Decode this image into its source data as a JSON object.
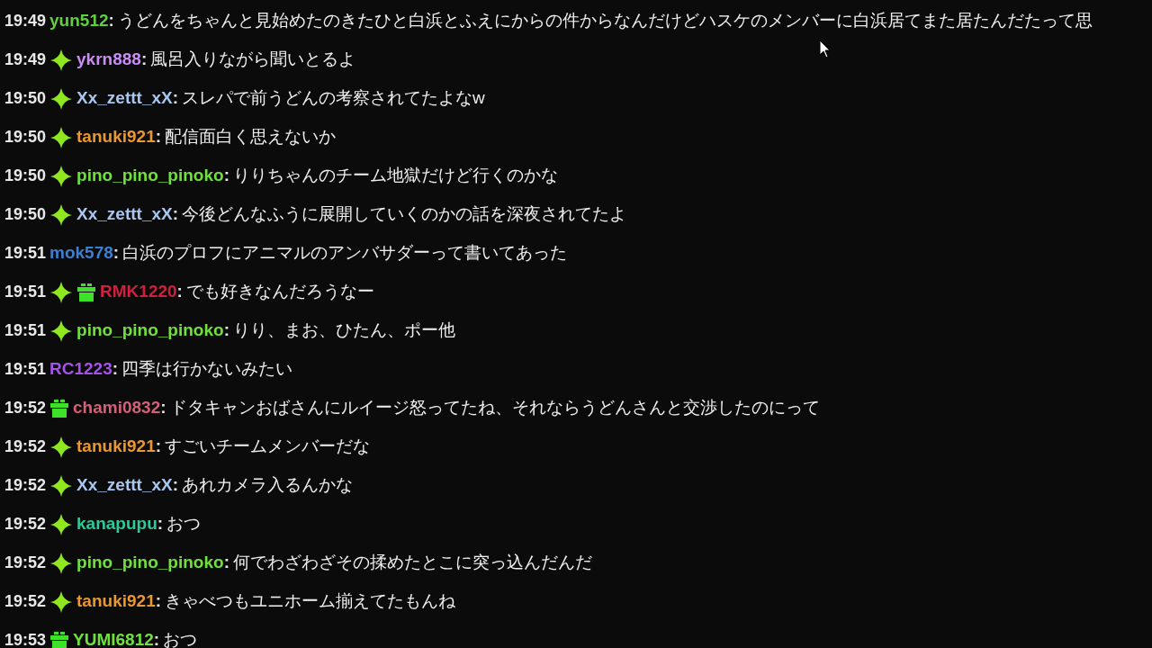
{
  "messages": [
    {
      "time": "19:49",
      "user": "yun512",
      "color": "#5fd13c",
      "separator": ":",
      "text": "うどんをちゃんと見始めたのきたひと白浜とふえにからの件からなんだけどハスケのメンバーに白浜居てまた居たんだたって思"
    },
    {
      "time": "19:49",
      "badges": [
        {
          "kind": "sparkle"
        }
      ],
      "user": "ykrn888",
      "color": "#c98cf5",
      "separator": ":",
      "text": "風呂入りながら聞いとるよ"
    },
    {
      "time": "19:50",
      "badges": [
        {
          "kind": "sparkle"
        }
      ],
      "user": "Xx_zettt_xX",
      "color": "#a9c6ee",
      "separator": ":",
      "text": "スレパで前うどんの考察されてたよなw"
    },
    {
      "time": "19:50",
      "badges": [
        {
          "kind": "sparkle"
        }
      ],
      "user": "tanuki921",
      "color": "#e8982f",
      "separator": ":",
      "text": "配信面白く思えないか"
    },
    {
      "time": "19:50",
      "badges": [
        {
          "kind": "sparkle"
        }
      ],
      "user": "pino_pino_pinoko",
      "color": "#70e03c",
      "separator": ":",
      "text": "りりちゃんのチーム地獄だけど行くのかな"
    },
    {
      "time": "19:50",
      "badges": [
        {
          "kind": "sparkle"
        }
      ],
      "user": "Xx_zettt_xX",
      "color": "#a9c6ee",
      "separator": ":",
      "text": "今後どんなふうに展開していくのかの話を深夜されてたよ"
    },
    {
      "time": "19:51",
      "user": "mok578",
      "color": "#3d7fd1",
      "separator": ":",
      "text": "白浜のプロフにアニマルのアンバサダーって書いてあった"
    },
    {
      "time": "19:51",
      "badges": [
        {
          "kind": "sparkle"
        },
        {
          "kind": "gift"
        }
      ],
      "user": "RMK1220",
      "color": "#d21f3e",
      "separator": ":",
      "text": "でも好きなんだろうなー"
    },
    {
      "time": "19:51",
      "badges": [
        {
          "kind": "sparkle"
        }
      ],
      "user": "pino_pino_pinoko",
      "color": "#70e03c",
      "separator": ":",
      "text": "りり、まお、ひたん、ポー他"
    },
    {
      "time": "19:51",
      "user": "RC1223",
      "color": "#a552e6",
      "separator": ":",
      "text": "四季は行かないみたい"
    },
    {
      "time": "19:52",
      "badges": [
        {
          "kind": "gift"
        }
      ],
      "user": "chami0832",
      "color": "#d65f78",
      "separator": ":",
      "text": "ドタキャンおばさんにルイージ怒ってたね、それならうどんさんと交渉したのにって"
    },
    {
      "time": "19:52",
      "badges": [
        {
          "kind": "sparkle"
        }
      ],
      "user": "tanuki921",
      "color": "#e8982f",
      "separator": ":",
      "text": "すごいチームメンバーだな"
    },
    {
      "time": "19:52",
      "badges": [
        {
          "kind": "sparkle"
        }
      ],
      "user": "Xx_zettt_xX",
      "color": "#a9c6ee",
      "separator": ":",
      "text": "あれカメラ入るんかな"
    },
    {
      "time": "19:52",
      "badges": [
        {
          "kind": "sparkle"
        }
      ],
      "user": "kanapupu",
      "color": "#2cc99a",
      "separator": ":",
      "text": "おつ"
    },
    {
      "time": "19:52",
      "badges": [
        {
          "kind": "sparkle"
        }
      ],
      "user": "pino_pino_pinoko",
      "color": "#70e03c",
      "separator": ":",
      "text": "何でわざわざその揉めたとこに突っ込んだんだ"
    },
    {
      "time": "19:52",
      "badges": [
        {
          "kind": "sparkle"
        }
      ],
      "user": "tanuki921",
      "color": "#e8982f",
      "separator": ":",
      "text": "きゃべつもユニホーム揃えてたもんね"
    },
    {
      "time": "19:53",
      "badges": [
        {
          "kind": "gift"
        }
      ],
      "user": "YUMI6812",
      "color": "#70e03c",
      "separator": ":",
      "text": "おつ"
    }
  ]
}
